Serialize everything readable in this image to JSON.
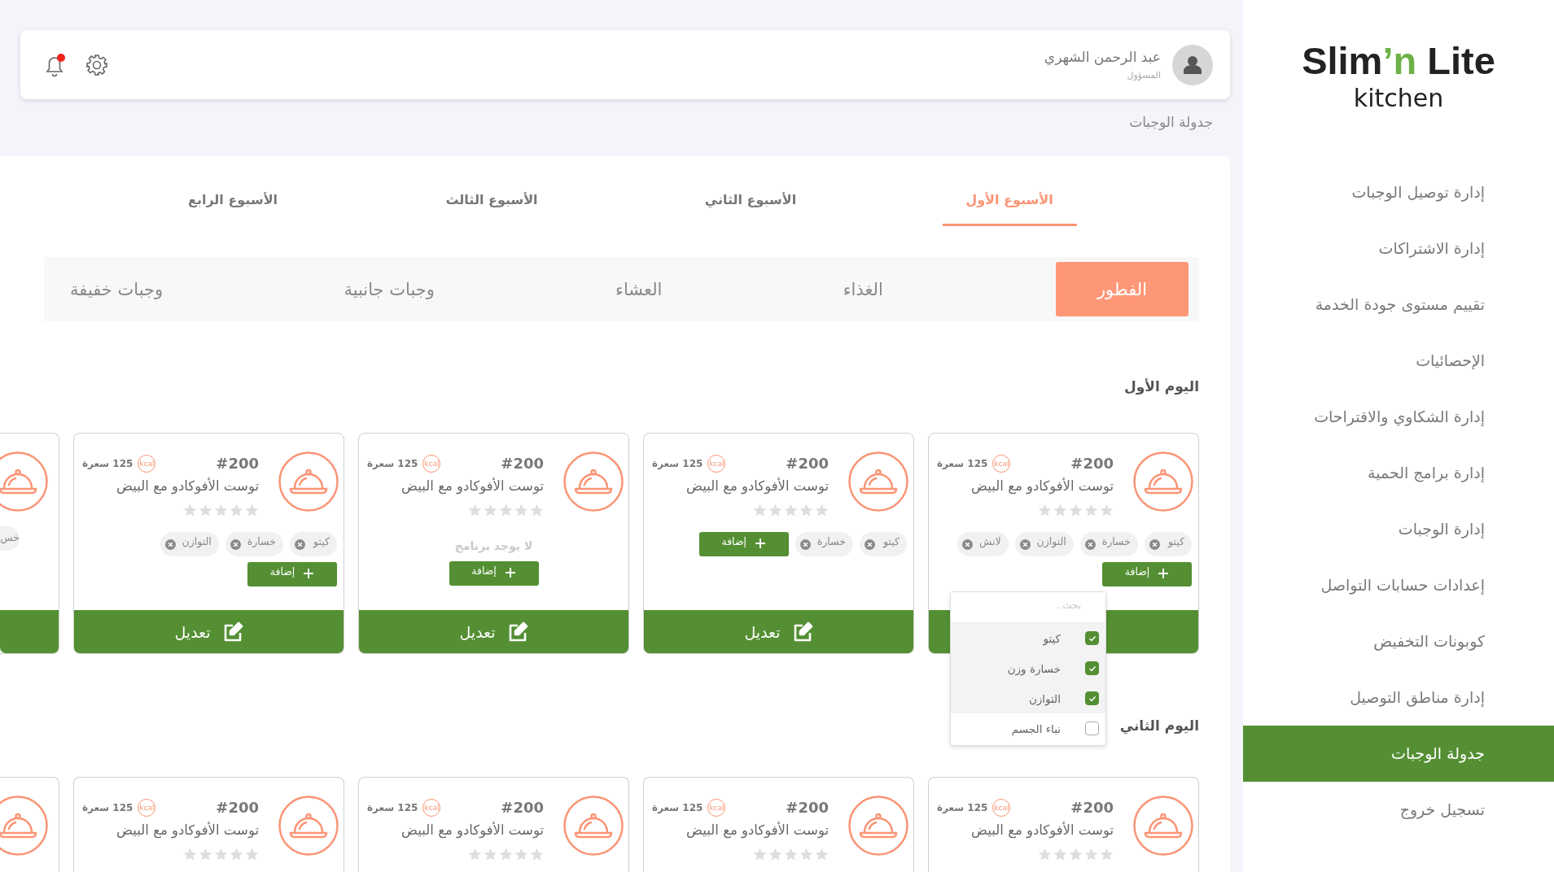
{
  "sidebar": {
    "logo": {
      "lead": "Slim",
      "accent": "’n",
      "tail": "Lite",
      "subtitle": "kitchen"
    },
    "items": [
      {
        "label": "إدارة توصيل الوجبات",
        "selected": false
      },
      {
        "label": "إدارة الاشتراكات",
        "selected": false
      },
      {
        "label": "تقييم مستوى جودة الخدمة",
        "selected": false
      },
      {
        "label": "الإحصائيات",
        "selected": false
      },
      {
        "label": "إدارة الشكاوي والاقتراحات",
        "selected": false
      },
      {
        "label": "إدارة برامج الحمية",
        "selected": false
      },
      {
        "label": "إدارة الوجبات",
        "selected": false
      },
      {
        "label": "إعدادات حسابات التواصل",
        "selected": false
      },
      {
        "label": "كوبونات التخفيض",
        "selected": false
      },
      {
        "label": "إدارة مناطق التوصيل",
        "selected": false
      },
      {
        "label": "جدولة الوجبات",
        "selected": true
      },
      {
        "label": "تسجيل خروج",
        "selected": false
      }
    ]
  },
  "header": {
    "user": {
      "name": "عبد الرحمن الشهري",
      "role": "المسؤول"
    },
    "notifications": {
      "unread": true
    }
  },
  "breadcrumb": "جدولة الوجبات",
  "week_tabs": [
    {
      "label": "الأسبوع الأول",
      "selected": true
    },
    {
      "label": "الأسبوع الثاني",
      "selected": false
    },
    {
      "label": "الأسبوع الثالث",
      "selected": false
    },
    {
      "label": "الأسبوع الرابع",
      "selected": false
    }
  ],
  "meal_tabs": [
    {
      "label": "الفطور",
      "selected": true
    },
    {
      "label": "الغذاء",
      "selected": false
    },
    {
      "label": "العشاء",
      "selected": false
    },
    {
      "label": "وجبات جانبية",
      "selected": false
    },
    {
      "label": "وجبات خفيفة",
      "selected": false
    }
  ],
  "days": [
    {
      "title": "اليوم الأول",
      "meals": [
        {
          "kind": "card",
          "number": "#200",
          "kcal": "kcal",
          "calories": "125 سعرة",
          "name": "توست الأفوكادو مع البيض",
          "stars": 0,
          "tags": [
            {
              "label": "كيتو"
            },
            {
              "label": "خسارة"
            },
            {
              "label": "التوازن"
            },
            {
              "label": "لانش"
            }
          ],
          "add_label": "إضافة",
          "picker": {
            "search_placeholder": "بحث..",
            "options": [
              {
                "label": "كيتو",
                "checked": true
              },
              {
                "label": "خسارة وزن",
                "checked": true
              },
              {
                "label": "التوازن",
                "checked": true
              },
              {
                "label": "نباء الجسم",
                "checked": false
              }
            ]
          }
        },
        {
          "kind": "card",
          "number": "#200",
          "kcal": "kcal",
          "calories": "125 سعرة",
          "name": "توست الأفوكادو مع البيض",
          "stars": 0,
          "tags": [
            {
              "label": "كيتو"
            },
            {
              "label": "خسارة"
            }
          ],
          "add_label": "إضافة",
          "edit_label": "تعديل"
        },
        {
          "kind": "card",
          "number": "#200",
          "kcal": "kcal",
          "calories": "125 سعرة",
          "name": "توست الأفوكادو مع البيض",
          "stars": 0,
          "empty_text": "لا يوجد برنامج",
          "add_label": "إضافة",
          "edit_label": "تعديل"
        },
        {
          "kind": "card",
          "number": "#200",
          "kcal": "kcal",
          "calories": "125 سعرة",
          "name": "توست الأفوكادو مع البيض",
          "stars": 0,
          "tags": [
            {
              "label": "كيتو"
            },
            {
              "label": "خسارة"
            },
            {
              "label": "التوازن"
            }
          ],
          "add_label": "إضافة",
          "edit_label": "تعديل"
        },
        {
          "kind": "partial",
          "tags": [
            {
              "label": "خس"
            }
          ]
        }
      ]
    },
    {
      "title": "اليوم الثاني",
      "meals": [
        {
          "kind": "card",
          "number": "#200",
          "kcal": "kcal",
          "calories": "125 سعرة",
          "name": "توست الأفوكادو مع البيض",
          "stars": 0
        },
        {
          "kind": "card",
          "number": "#200",
          "kcal": "kcal",
          "calories": "125 سعرة",
          "name": "توست الأفوكادو مع البيض",
          "stars": 0
        },
        {
          "kind": "card",
          "number": "#200",
          "kcal": "kcal",
          "calories": "125 سعرة",
          "name": "توست الأفوكادو مع البيض",
          "stars": 0
        },
        {
          "kind": "card",
          "number": "#200",
          "kcal": "kcal",
          "calories": "125 سعرة",
          "name": "توست الأفوكادو مع البيض",
          "stars": 0
        },
        {
          "kind": "partial"
        }
      ]
    }
  ]
}
